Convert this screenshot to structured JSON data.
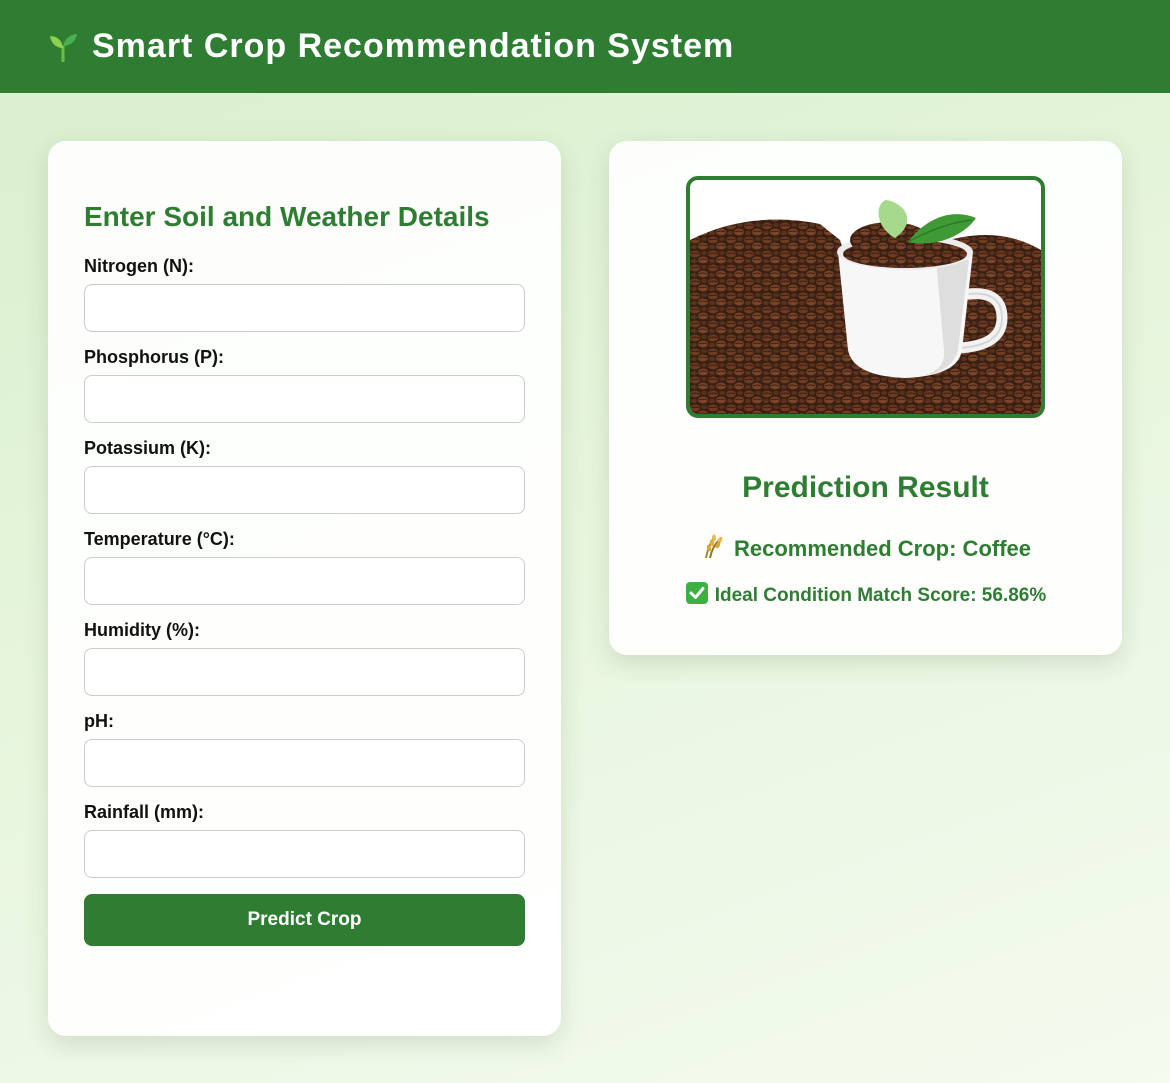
{
  "header": {
    "title": "Smart Crop Recommendation System",
    "icon": "sprout-icon"
  },
  "form": {
    "heading": "Enter Soil and Weather Details",
    "fields": [
      {
        "label": "Nitrogen (N):",
        "value": "",
        "placeholder": ""
      },
      {
        "label": "Phosphorus (P):",
        "value": "",
        "placeholder": ""
      },
      {
        "label": "Potassium (K):",
        "value": "",
        "placeholder": ""
      },
      {
        "label": "Temperature (°C):",
        "value": "",
        "placeholder": ""
      },
      {
        "label": "Humidity (%):",
        "value": "",
        "placeholder": ""
      },
      {
        "label": "pH:",
        "value": "",
        "placeholder": ""
      },
      {
        "label": "Rainfall (mm):",
        "value": "",
        "placeholder": ""
      }
    ],
    "submit_label": "Predict Crop"
  },
  "result": {
    "heading": "Prediction Result",
    "crop_icon": "rice-sheaf-icon",
    "crop_text": "Recommended Crop: Coffee",
    "score_icon": "check-mark-icon",
    "score_text": "Ideal Condition Match Score: 56.86%",
    "image": "coffee-cup-with-beans-and-leaves"
  },
  "colors": {
    "primary": "#2e7d32",
    "background": "#e6f5dc",
    "card": "#ffffff"
  }
}
